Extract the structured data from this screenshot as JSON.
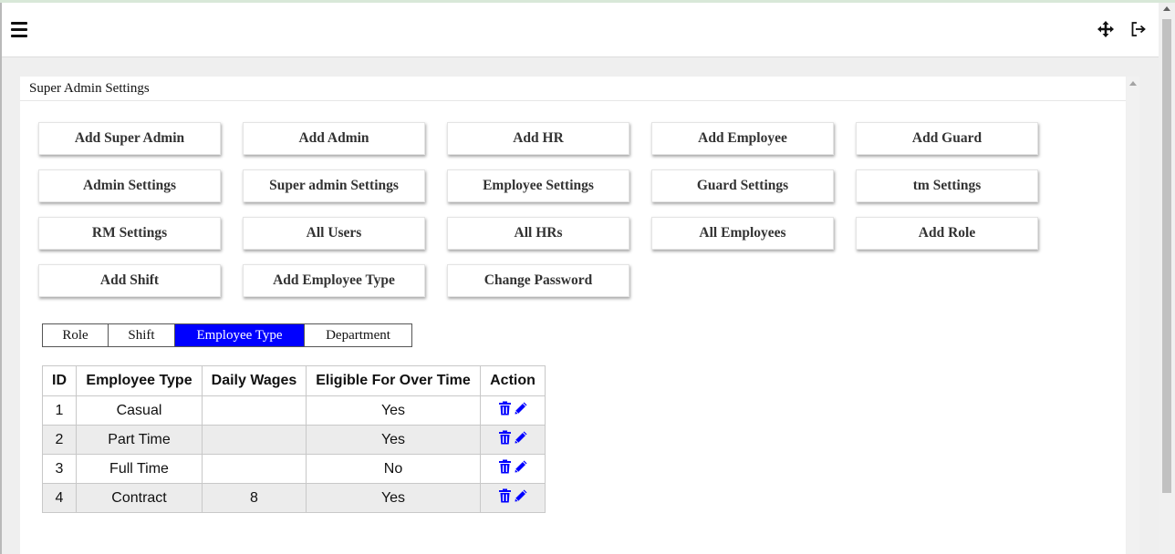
{
  "header": {
    "menu_icon": "hamburger-menu-icon",
    "move_icon": "move-arrows-icon",
    "logout_icon": "logout-icon"
  },
  "panel": {
    "title": "Super Admin Settings"
  },
  "buttons": [
    {
      "label": "Add Super Admin"
    },
    {
      "label": "Add Admin"
    },
    {
      "label": "Add HR"
    },
    {
      "label": "Add Employee"
    },
    {
      "label": "Add Guard"
    },
    {
      "label": "Admin Settings"
    },
    {
      "label": "Super admin Settings"
    },
    {
      "label": "Employee Settings"
    },
    {
      "label": "Guard Settings"
    },
    {
      "label": "tm Settings"
    },
    {
      "label": "RM Settings"
    },
    {
      "label": "All Users"
    },
    {
      "label": "All HRs"
    },
    {
      "label": "All Employees"
    },
    {
      "label": "Add Role"
    },
    {
      "label": "Add Shift"
    },
    {
      "label": "Add Employee Type"
    },
    {
      "label": "Change Password"
    }
  ],
  "tabs": [
    {
      "label": "Role",
      "active": false
    },
    {
      "label": "Shift",
      "active": false
    },
    {
      "label": "Employee Type",
      "active": true
    },
    {
      "label": "Department",
      "active": false
    }
  ],
  "table": {
    "headers": [
      "ID",
      "Employee Type",
      "Daily Wages",
      "Eligible For Over Time",
      "Action"
    ],
    "rows": [
      {
        "id": "1",
        "type": "Casual",
        "wages": "",
        "overtime": "Yes"
      },
      {
        "id": "2",
        "type": "Part Time",
        "wages": "",
        "overtime": "Yes"
      },
      {
        "id": "3",
        "type": "Full Time",
        "wages": "",
        "overtime": "No"
      },
      {
        "id": "4",
        "type": "Contract",
        "wages": "8",
        "overtime": "Yes"
      }
    ],
    "action_icons": [
      "trash-icon",
      "pencil-icon"
    ]
  },
  "colors": {
    "active_tab_bg": "#0000ff",
    "action_icon": "#0000ff",
    "row_alt_bg": "#ececec"
  }
}
